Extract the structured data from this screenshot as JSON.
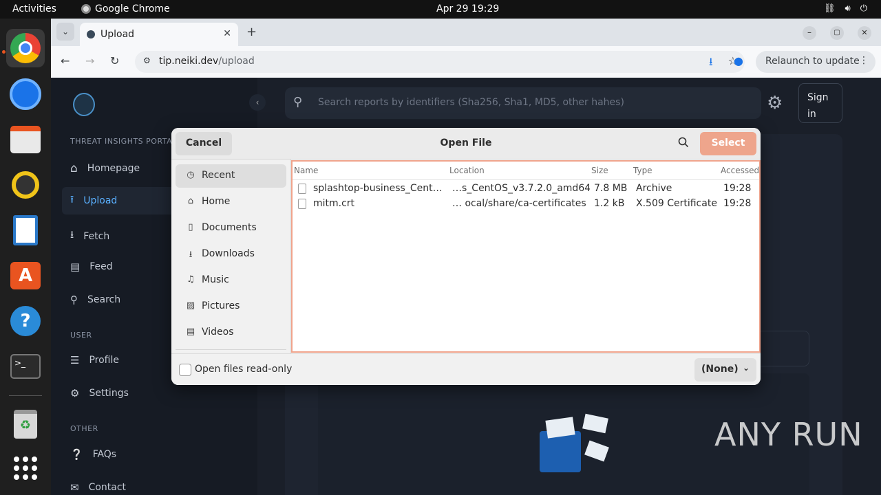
{
  "topbar": {
    "activities": "Activities",
    "app_name": "Google Chrome",
    "clock": "Apr 29  19:29"
  },
  "browser": {
    "tab_title": "Upload",
    "url_domain": "tip.neiki.dev",
    "url_path": "/upload",
    "relaunch_label": "Relaunch to update"
  },
  "site": {
    "section_portal": "THREAT INSIGHTS PORTAL",
    "nav": [
      {
        "label": "Homepage"
      },
      {
        "label": "Upload"
      },
      {
        "label": "Fetch"
      },
      {
        "label": "Feed"
      },
      {
        "label": "Search"
      }
    ],
    "section_user": "USER",
    "user_nav": [
      {
        "label": "Profile"
      },
      {
        "label": "Settings"
      }
    ],
    "section_other": "OTHER",
    "other_nav": [
      {
        "label": "FAQs"
      },
      {
        "label": "Contact"
      }
    ],
    "search_placeholder": "Search reports by identifiers (Sha256, Sha1, MD5, other hahes)",
    "signin": "Sign in"
  },
  "dialog": {
    "cancel": "Cancel",
    "title": "Open File",
    "select": "Select",
    "places": [
      {
        "label": "Recent",
        "icon": "clock-icon"
      },
      {
        "label": "Home",
        "icon": "home-icon"
      },
      {
        "label": "Documents",
        "icon": "document-icon"
      },
      {
        "label": "Downloads",
        "icon": "download-icon"
      },
      {
        "label": "Music",
        "icon": "music-icon"
      },
      {
        "label": "Pictures",
        "icon": "picture-icon"
      },
      {
        "label": "Videos",
        "icon": "video-icon"
      }
    ],
    "columns": {
      "name": "Name",
      "location": "Location",
      "size": "Size",
      "type": "Type",
      "accessed": "Accessed"
    },
    "files": [
      {
        "name": "splashtop-business_Cent…",
        "location": "…s_CentOS_v3.7.2.0_amd64",
        "size": "7.8 MB",
        "type": "Archive",
        "accessed": "19:28"
      },
      {
        "name": "mitm.crt",
        "location": "… ocal/share/ca-certificates",
        "size": "1.2 kB",
        "type": "X.509 Certificate",
        "accessed": "19:28"
      }
    ],
    "readonly_label": "Open files read-only",
    "filter": "(None)"
  },
  "watermark": "ANY RUN"
}
